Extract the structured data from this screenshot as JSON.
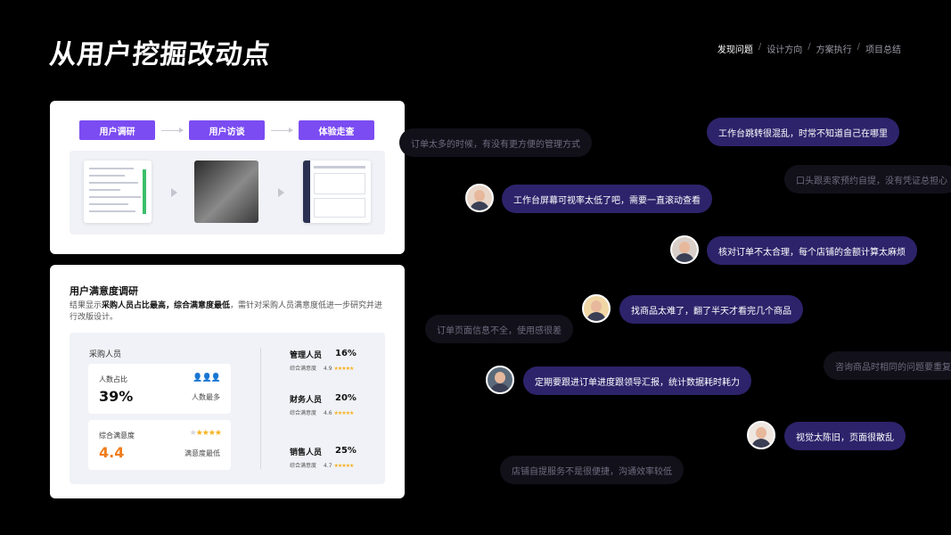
{
  "page": {
    "title": "从用户挖掘改动点"
  },
  "breadcrumb": {
    "items": [
      "发现问题",
      "设计方向",
      "方案执行",
      "项目总结"
    ],
    "separator": "/"
  },
  "research_flow": {
    "steps": [
      "用户调研",
      "用户访谈",
      "体验走查"
    ]
  },
  "survey": {
    "title": "用户满意度调研",
    "desc_prefix": "结果显示",
    "desc_bold1": "采购人员占比最高，综合满意度最低",
    "desc_suffix": "，需针对采购人员满意度低进一步研究并进行改版设计。",
    "group_label": "采购人员",
    "metric_share": {
      "label": "人数占比",
      "value": "39%",
      "note": "人数最多",
      "icon": "people-icon"
    },
    "metric_satisfaction": {
      "label": "综合满意度",
      "value": "4.4",
      "note": "满意度最低",
      "stars": "★★★★",
      "star_off": "★"
    },
    "roles": [
      {
        "name": "管理人员",
        "pct": "16%",
        "sub": "综合满意度",
        "score": "4.9",
        "stars": "★★★★★"
      },
      {
        "name": "财务人员",
        "pct": "20%",
        "sub": "综合满意度",
        "score": "4.6",
        "stars": "★★★★★"
      },
      {
        "name": "销售人员",
        "pct": "25%",
        "sub": "综合满意度",
        "score": "4.7",
        "stars": "★★★★★"
      }
    ]
  },
  "feedback": {
    "b1": "订单太多的时候，有没有更方便的管理方式",
    "b2": "工作台跳转很混乱，时常不知道自己在哪里",
    "b3": "口头跟卖家预约自提，没有凭证总担心",
    "b4": "工作台屏幕可视率太低了吧，需要一直滚动查看",
    "b5": "核对订单不太合理，每个店铺的金额计算太麻烦",
    "b6": "找商品太难了，翻了半天才看完几个商品",
    "b7": "订单页面信息不全，使用感很差",
    "b8": "咨询商品时相同的问题要重复",
    "b9": "定期要跟进订单进度跟领导汇报，统计数据耗时耗力",
    "b10": "视觉太陈旧，页面很散乱",
    "b11": "店铺自提服务不是很便捷，沟通效率较低"
  },
  "colors": {
    "accent": "#7b4cf2",
    "bubble": "#2d236b",
    "highlight": "#f07d1a",
    "star": "#f5b21f"
  }
}
